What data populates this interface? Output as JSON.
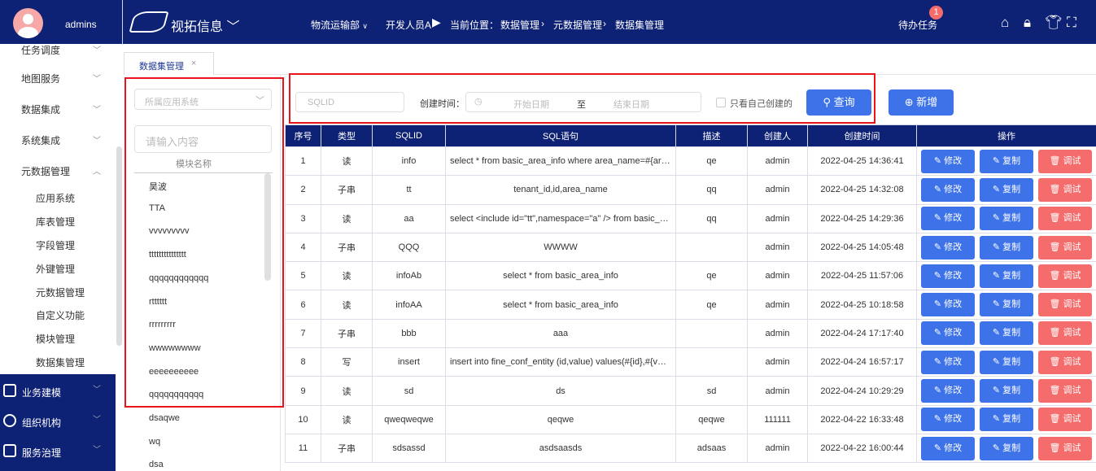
{
  "header": {
    "user": "admins",
    "brand": "视拓信息",
    "dept": "物流运输部",
    "dev": "开发人员A",
    "location_label": "当前位置：",
    "breadcrumb": [
      "数据管理",
      "元数据管理",
      "数据集管理"
    ],
    "todo": "待办任务",
    "todo_count": "1"
  },
  "sidebar": {
    "items": [
      "任务调度",
      "地图服务",
      "数据集成",
      "系统集成",
      "元数据管理"
    ],
    "sub_items": [
      "应用系统",
      "库表管理",
      "字段管理",
      "外键管理",
      "元数据管理",
      "自定义功能",
      "模块管理",
      "数据集管理"
    ],
    "dark_items": [
      "业务建模",
      "组织机构",
      "服务治理"
    ]
  },
  "tab": {
    "label": "数据集管理",
    "close": "×"
  },
  "module_panel": {
    "select_placeholder": "所属应用系统",
    "search_placeholder": "请输入内容",
    "column": "模块名称",
    "items": [
      "昊波",
      "TTA",
      "vvvvvvvvv",
      "ttttttttttttttt",
      "qqqqqqqqqqqq",
      "rtttttt",
      "rrrrrrrrr",
      "wwwwwwww",
      "eeeeeeeeee",
      "qqqqqqqqqqq",
      "dsaqwe",
      "wq",
      "dsa"
    ]
  },
  "filters": {
    "sqlid_placeholder": "SQLID",
    "time_label": "创建时间：",
    "start_placeholder": "开始日期",
    "to": "至",
    "end_placeholder": "结束日期",
    "only_mine": "只看自己创建的",
    "query": "查询",
    "add": "新增"
  },
  "table": {
    "headers": [
      "序号",
      "类型",
      "SQLID",
      "SQL语句",
      "描述",
      "创建人",
      "创建时间",
      "操作"
    ],
    "actions": {
      "edit": "修改",
      "copy": "复制",
      "debug": "调试"
    },
    "rows": [
      [
        "1",
        "读",
        "info",
        "select * from basic_area_info where area_name=#{area}",
        "qe",
        "admin",
        "2022-04-25 14:36:41"
      ],
      [
        "2",
        "子串",
        "tt",
        "tenant_id,id,area_name",
        "qq",
        "admin",
        "2022-04-25 14:32:08"
      ],
      [
        "3",
        "读",
        "aa",
        "select <include id=\"tt\",namespace=\"a\" /> from basic_area_info",
        "qq",
        "admin",
        "2022-04-25 14:29:36"
      ],
      [
        "4",
        "子串",
        "QQQ",
        "WWWW",
        "",
        "admin",
        "2022-04-25 14:05:48"
      ],
      [
        "5",
        "读",
        "infoAb",
        "select * from basic_area_info",
        "qe",
        "admin",
        "2022-04-25 11:57:06"
      ],
      [
        "6",
        "读",
        "infoAA",
        "select * from basic_area_info",
        "qe",
        "admin",
        "2022-04-25 10:18:58"
      ],
      [
        "7",
        "子串",
        "bbb",
        "aaa",
        "",
        "admin",
        "2022-04-24 17:17:40"
      ],
      [
        "8",
        "写",
        "insert",
        "insert into fine_conf_entity (id,value) values(#{id},#{value})",
        "",
        "admin",
        "2022-04-24 16:57:17"
      ],
      [
        "9",
        "读",
        "sd",
        "ds",
        "sd",
        "admin",
        "2022-04-24 10:29:29"
      ],
      [
        "10",
        "读",
        "qweqweqwe",
        "qeqwe",
        "qeqwe",
        "111111",
        "2022-04-22 16:33:48"
      ],
      [
        "11",
        "子串",
        "sdsassd",
        "asdsaasds",
        "adsaas",
        "admin",
        "2022-04-22 16:00:44"
      ]
    ]
  }
}
